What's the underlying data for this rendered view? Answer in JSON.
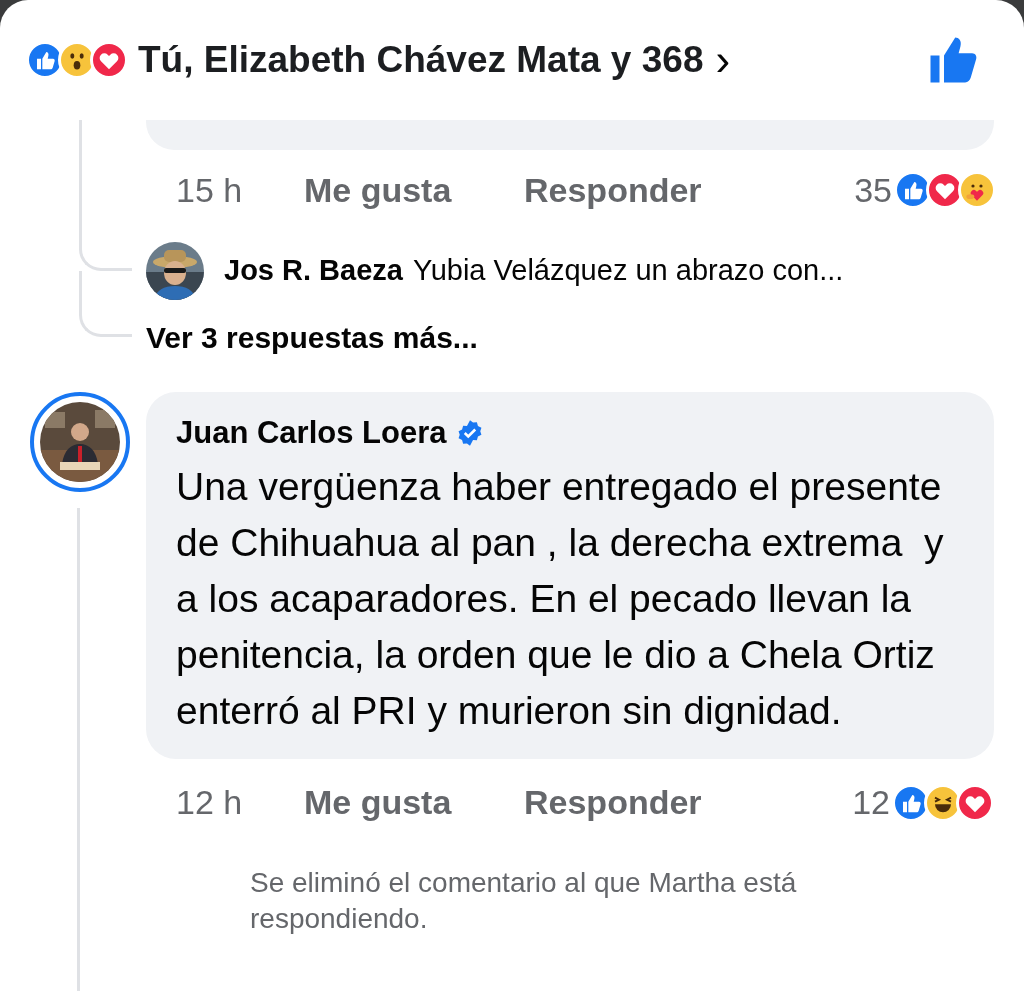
{
  "header": {
    "reactions": [
      {
        "kind": "like"
      },
      {
        "kind": "wow"
      },
      {
        "kind": "love"
      }
    ],
    "summary": "Tú, Elizabeth Chávez Mata y 368",
    "chevron": "›",
    "liked": true
  },
  "previous_comment": {
    "time": "15 h",
    "like_label": "Me gusta",
    "reply_label": "Responder",
    "reaction_count": "35",
    "reactions": [
      {
        "kind": "like"
      },
      {
        "kind": "love"
      },
      {
        "kind": "care"
      }
    ]
  },
  "reply_preview": {
    "author": "Jos R. Baeza",
    "text": "Yubia Velázquez un abrazo con..."
  },
  "more_replies": "Ver 3 respuestas más...",
  "comment": {
    "author": "Juan Carlos Loera",
    "verified": true,
    "text": "Una vergüenza haber entregado el presente de Chihuahua al pan , la derecha extrema  y  a los acaparadores. En el pecado llevan la penitencia, la orden que le dio a Chela Ortiz enterró al PRI y murieron sin dignidad.",
    "time": "12 h",
    "like_label": "Me gusta",
    "reply_label": "Responder",
    "reaction_count": "12",
    "reactions": [
      {
        "kind": "like"
      },
      {
        "kind": "haha"
      },
      {
        "kind": "love"
      }
    ]
  },
  "deleted_notice": "Se eliminó el comentario al que Martha está respondiendo."
}
